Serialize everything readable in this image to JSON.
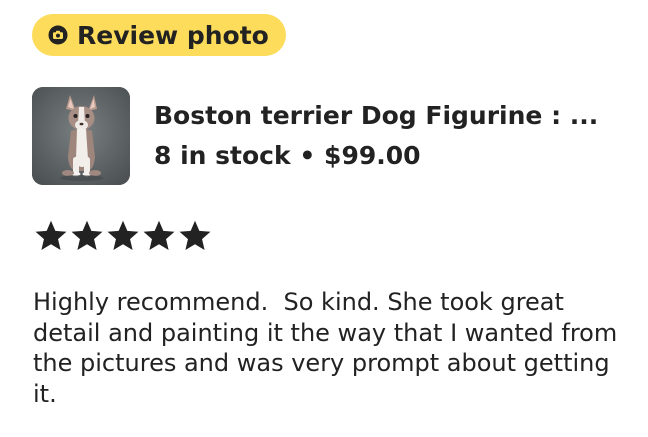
{
  "badge": {
    "icon": "camera-icon",
    "label": "Review photo",
    "color": "#fcdc5a"
  },
  "product": {
    "thumbnail_icon": "boston-terrier-figurine-photo",
    "title": "Boston terrier Dog Figurine : ...",
    "stock": "8 in stock",
    "separator": "•",
    "price": "$99.00"
  },
  "rating": {
    "stars": 5,
    "max": 5,
    "icon": "star-icon"
  },
  "review": {
    "text": "Highly recommend.  So kind. She took great detail and painting it the way that I wanted from the pictures and was very prompt about getting it."
  }
}
